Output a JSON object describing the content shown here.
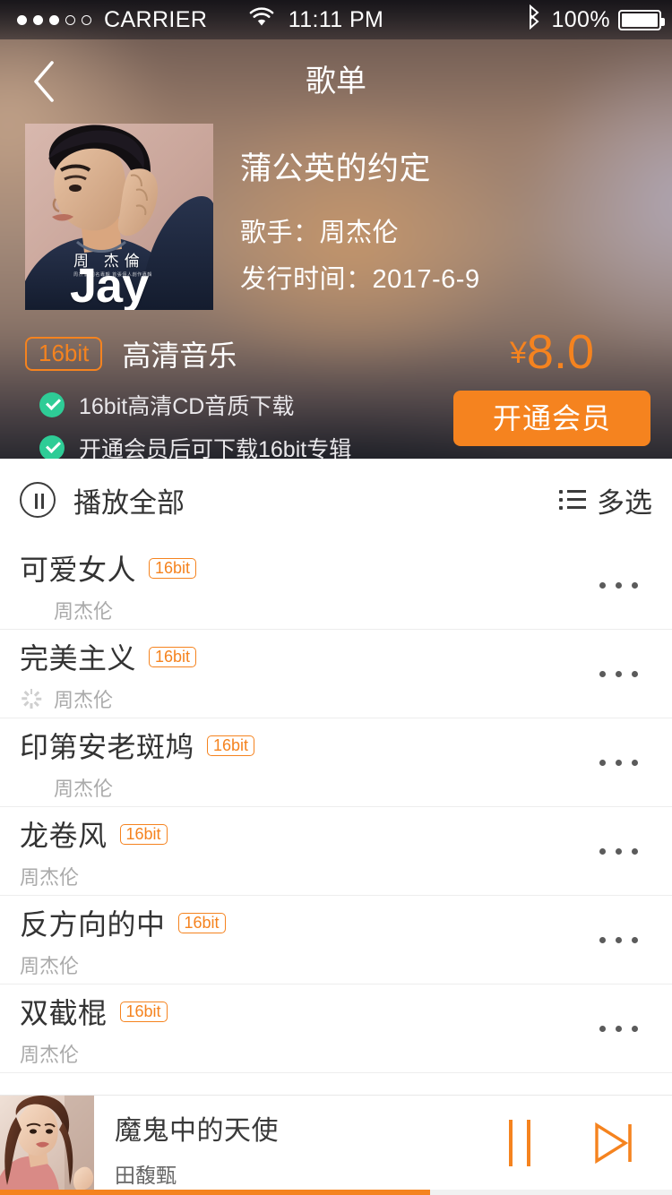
{
  "status_bar": {
    "signal_dots_filled": 3,
    "signal_dots_total": 5,
    "carrier": "CARRIER",
    "wifi_icon": "wifi-icon",
    "time": "11:11 PM",
    "bluetooth_icon": "bluetooth-icon",
    "battery_percent": "100%"
  },
  "nav": {
    "back_icon": "chevron-left-icon",
    "title": "歌单"
  },
  "album": {
    "cover_alt": "album-cover-jay",
    "cover_text_latin": "Jay",
    "cover_text_cn": "周 杰倫",
    "cover_text_cnsub": "周杰倫 同名專輯 首張個人創作專輯",
    "title": "蒲公英的约定",
    "artist_line": "歌手：周杰伦",
    "release_line": "发行时间：2017-6-9"
  },
  "quality": {
    "badge": "16bit",
    "name": "高清音乐",
    "features": [
      "16bit高清CD音质下载",
      "开通会员后可下载16bit专辑"
    ],
    "check_icon": "check-circle-icon"
  },
  "purchase": {
    "currency": "¥",
    "price": "8.0",
    "vip_button": "开通会员"
  },
  "play_bar": {
    "pause_icon": "pause-circle-icon",
    "play_all_label": "播放全部",
    "multi_icon": "list-icon",
    "multi_select_label": "多选"
  },
  "songs": [
    {
      "name": "可爱女人",
      "tag": "16bit",
      "artist": "周杰伦",
      "state": "downloaded",
      "state_icon": "check-circle-orange-icon",
      "more_icon": "more-dots-icon"
    },
    {
      "name": "完美主义",
      "tag": "16bit",
      "artist": "周杰伦",
      "state": "loading",
      "state_icon": "spinner-icon",
      "more_icon": "more-dots-icon"
    },
    {
      "name": "印第安老斑鸠",
      "tag": "16bit",
      "artist": "周杰伦",
      "state": "downloaded",
      "state_icon": "check-circle-orange-icon",
      "more_icon": "more-dots-icon"
    },
    {
      "name": "龙卷风",
      "tag": "16bit",
      "artist": "周杰伦",
      "state": "none",
      "state_icon": "",
      "more_icon": "more-dots-icon"
    },
    {
      "name": "反方向的中",
      "tag": "16bit",
      "artist": "周杰伦",
      "state": "none",
      "state_icon": "",
      "more_icon": "more-dots-icon"
    },
    {
      "name": "双截棍",
      "tag": "16bit",
      "artist": "周杰伦",
      "state": "none",
      "state_icon": "",
      "more_icon": "more-dots-icon"
    }
  ],
  "mini_player": {
    "thumb_alt": "now-playing-artwork",
    "title": "魔鬼中的天使",
    "artist": "田馥甄",
    "pause_icon": "pause-icon",
    "next_icon": "next-track-icon",
    "progress_percent": 64
  },
  "colors": {
    "accent_orange": "#f5831f",
    "check_green": "#2ecc96",
    "text_primary": "#333333",
    "text_muted": "#aaaaaa",
    "divider": "#ededed"
  }
}
